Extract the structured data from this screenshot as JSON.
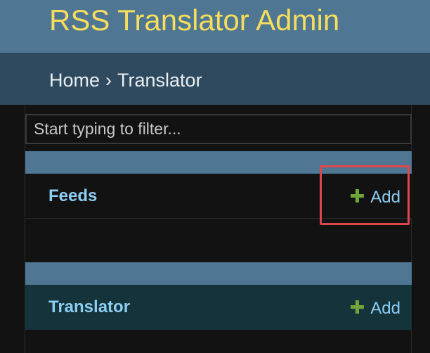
{
  "header": {
    "site_title": "RSS Translator Admin"
  },
  "breadcrumbs": {
    "home": "Home",
    "separator": "›",
    "current": "Translator"
  },
  "sidebar": {
    "filter": {
      "placeholder": "Start typing to filter...",
      "value": ""
    },
    "apps": [
      {
        "models": [
          {
            "label": "Feeds",
            "add_label": "Add",
            "add_icon": "plus-icon"
          }
        ]
      },
      {
        "models": [
          {
            "label": "Translator",
            "add_label": "Add",
            "add_icon": "plus-icon"
          }
        ]
      }
    ]
  },
  "colors": {
    "header_bg": "#4f7692",
    "title": "#f5dd5d",
    "breadcrumb_bg": "#2f4a5e",
    "link": "#8dcdf2",
    "add_icon": "#6fa53a",
    "highlight": "#e0474c"
  }
}
